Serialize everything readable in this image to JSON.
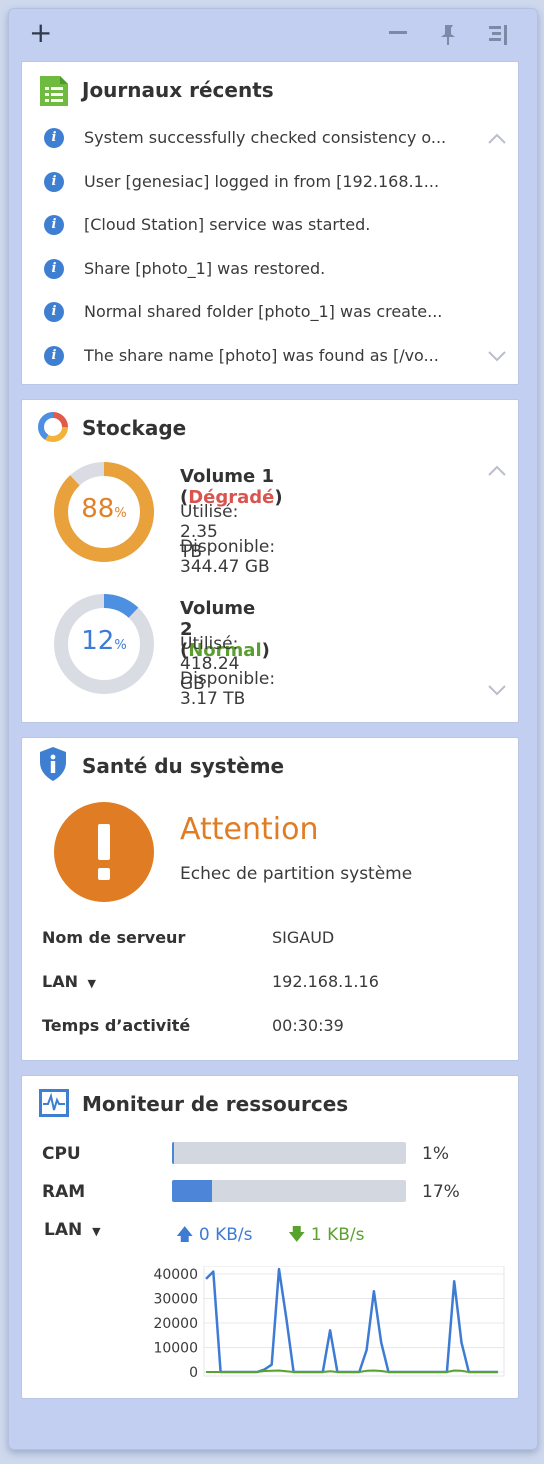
{
  "toolbar": {
    "add_icon": "plus-icon",
    "minimize_icon": "minus-icon",
    "pin_icon": "pin-icon",
    "sidebar_icon": "sidebar-toggle-icon"
  },
  "logs": {
    "title": "Journaux récents",
    "icon": "list-document-icon",
    "items": [
      {
        "icon": "info-icon",
        "text": "System successfully checked consistency o..."
      },
      {
        "icon": "info-icon",
        "text": "User [genesiac] logged in from [192.168.1..."
      },
      {
        "icon": "info-icon",
        "text": "[Cloud Station] service was started."
      },
      {
        "icon": "info-icon",
        "text": "Share [photo_1] was restored."
      },
      {
        "icon": "info-icon",
        "text": "Normal shared folder [photo_1] was create..."
      },
      {
        "icon": "info-icon",
        "text": "The share name [photo] was found as [/vo..."
      }
    ]
  },
  "storage": {
    "title": "Stockage",
    "icon": "storage-donut-icon",
    "volumes": [
      {
        "name": "Volume 1",
        "status": "Dégradé",
        "status_color": "#d9534f",
        "used": "Utilisé: 2.35 TB",
        "available": "Disponible: 344.47 GB",
        "percent": 88,
        "percent_label": "88",
        "ring_color": "#e8a13b",
        "text_color": "#e0822a"
      },
      {
        "name": "Volume 2",
        "status": "Normal",
        "status_color": "#5a9e2f",
        "used": "Utilisé: 418.24 GB",
        "available": "Disponible: 3.17 TB",
        "percent": 12,
        "percent_label": "12",
        "ring_color": "#4d8fe0",
        "text_color": "#3e7bd4"
      }
    ],
    "percent_unit": "%",
    "open_paren": "(",
    "close_paren": ")"
  },
  "health": {
    "title": "Santé du système",
    "icon": "shield-info-icon",
    "status_icon": "exclamation-icon",
    "status": "Attention",
    "message": "Echec de partition système",
    "status_color": "#e07d24",
    "fields": [
      {
        "label": "Nom de serveur",
        "value": "SIGAUD"
      },
      {
        "label": "LAN",
        "value": "192.168.1.16"
      },
      {
        "label": "Temps d’activité",
        "value": "00:30:39"
      }
    ]
  },
  "resources": {
    "title": "Moniteur de ressources",
    "icon": "activity-monitor-icon",
    "cpu_label": "CPU",
    "cpu_value": 1,
    "cpu_text": "1%",
    "ram_label": "RAM",
    "ram_value": 17,
    "ram_text": "17%",
    "lan_label": "LAN",
    "upload": "0 KB/s",
    "download": "1 KB/s",
    "upload_color": "#3e7bd4",
    "download_color": "#5aa22e"
  },
  "chart_data": {
    "type": "line",
    "ylim": [
      0,
      40000
    ],
    "yticks": [
      "40000",
      "30000",
      "20000",
      "10000",
      "0"
    ],
    "grid": true,
    "series": [
      {
        "color": "#3e7bd4",
        "values": [
          38000,
          41000,
          0,
          0,
          0,
          0,
          0,
          0,
          1000,
          3000,
          42000,
          22000,
          0,
          0,
          0,
          0,
          0,
          17000,
          0,
          0,
          0,
          0,
          9000,
          33000,
          12000,
          0,
          0,
          0,
          0,
          0,
          0,
          0,
          0,
          0,
          37000,
          12000,
          0,
          0,
          0,
          0,
          0
        ]
      },
      {
        "color": "#5aa22e",
        "values": [
          0,
          0,
          0,
          0,
          0,
          0,
          0,
          0,
          400,
          500,
          600,
          300,
          0,
          0,
          0,
          0,
          0,
          300,
          0,
          0,
          0,
          0,
          500,
          600,
          400,
          0,
          0,
          0,
          0,
          0,
          0,
          0,
          0,
          0,
          600,
          500,
          0,
          0,
          0,
          0,
          0
        ]
      }
    ]
  }
}
